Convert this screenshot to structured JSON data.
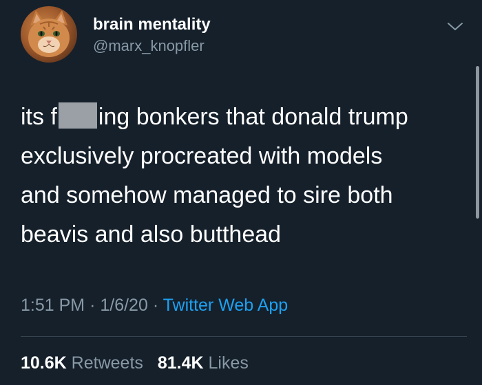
{
  "tweet": {
    "user": {
      "display_name": "brain mentality",
      "handle": "@marx_knopfler"
    },
    "text_lines": {
      "line1_before": "its f",
      "line1_after": "ing bonkers that donald trump",
      "line2": "exclusively procreated with models",
      "line3": "and somehow managed to sire both",
      "line4": "beavis and also butthead"
    },
    "meta": {
      "time": "1:51 PM",
      "date": "1/6/20",
      "separator": "·",
      "source": "Twitter Web App"
    },
    "stats": {
      "retweets_count": "10.6K",
      "retweets_label": "Retweets",
      "likes_count": "81.4K",
      "likes_label": "Likes"
    }
  },
  "colors": {
    "background": "#15202b",
    "text_primary": "#ffffff",
    "text_secondary": "#8899a6",
    "link": "#1da1f2",
    "censor_block": "#9aa0a6",
    "divider": "#38444d"
  },
  "icons": {
    "menu": "chevron-down-icon",
    "avatar": "orange-cat-photo"
  }
}
